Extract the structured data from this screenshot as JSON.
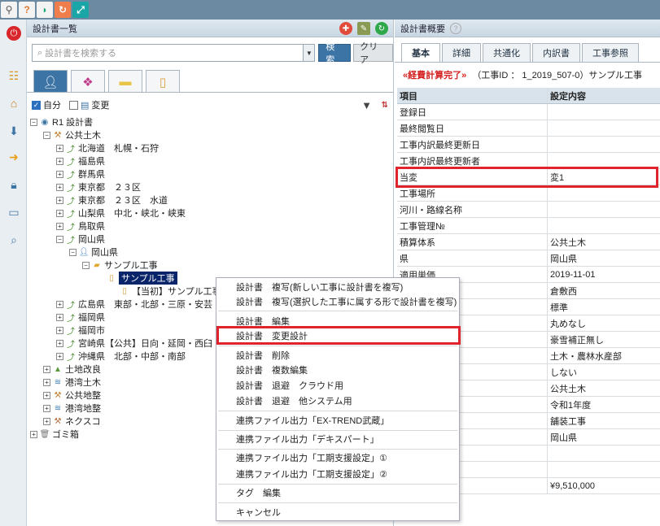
{
  "colors": {
    "toolbar": "#6d8aa3",
    "accent": "#3d74a6",
    "highlight_box": "#e0242e",
    "selection": "#0a246a"
  },
  "toolbar": {
    "icons": [
      "pin-icon",
      "help-icon",
      "shield-icon",
      "refresh-icon",
      "resize-icon"
    ]
  },
  "left_panel": {
    "title": "設計書一覧",
    "search": {
      "placeholder": "設計書を検索する",
      "search_label": "検索",
      "clear_label": "クリア"
    },
    "filters": {
      "own_label": "自分",
      "own_checked": true,
      "change_label": "変更",
      "change_checked": false
    },
    "tree": {
      "root": "R1 設計書",
      "public_works": "公共土木",
      "pref_1": "北海道　札幌・石狩",
      "pref_2": "福島県",
      "pref_3": "群馬県",
      "pref_4": "東京都　２３区",
      "pref_5": "東京都　２３区　水道",
      "pref_6": "山梨県　中北・峡北・峡東",
      "pref_7": "鳥取県",
      "pref_8": "岡山県",
      "okayama_user": "岡山県",
      "sample_folder": "サンプル工事",
      "selected": "サンプル工事",
      "initial": "【当初】サンプル工事",
      "pref_9": "広島県　東部・北部・三原・安芸",
      "pref_10": "福岡県",
      "pref_11": "福岡市",
      "pref_12": "宮崎県【公共】日向・延岡・西臼",
      "pref_13": "沖縄県　北部・中部・南部",
      "land": "土地改良",
      "harbor": "港湾土木",
      "park": "公共地整",
      "harbor2": "港湾地整",
      "nexco": "ネクスコ",
      "trash": "ゴミ箱"
    }
  },
  "context_menu": {
    "items": [
      "設計書　複写(新しい工事に設計書を複写)",
      "設計書　複写(選択した工事に属する形で設計書を複写)",
      "設計書　編集",
      "設計書　変更設計",
      "設計書　削除",
      "設計書　複数編集",
      "設計書　退避　クラウド用",
      "設計書　退避　他システム用",
      "連携ファイル出力「EX-TREND武蔵」",
      "連携ファイル出力「デキスパート」",
      "連携ファイル出力「工期支援設定」①",
      "連携ファイル出力「工期支援設定」②",
      "タグ　編集",
      "キャンセル"
    ]
  },
  "right_panel": {
    "title": "設計書概要",
    "tabs": [
      "基本",
      "詳細",
      "共通化",
      "内訳書",
      "工事参照"
    ],
    "status_done": "«経費計算完了»",
    "status_info": "（工事ID ： 1_2019_507-0）サンプル工事",
    "grid": {
      "header": [
        "項目",
        "設定内容"
      ],
      "rows": [
        [
          "登録日",
          ""
        ],
        [
          "最終閲覧日",
          ""
        ],
        [
          "工事内訳最終更新日",
          ""
        ],
        [
          "工事内訳最終更新者",
          ""
        ],
        [
          "当変",
          "変1"
        ],
        [
          "工事場所",
          ""
        ],
        [
          "河川・路線名称",
          ""
        ],
        [
          "工事管理№",
          ""
        ],
        [
          "積算体系",
          "公共土木"
        ],
        [
          "県",
          "岡山県"
        ],
        [
          "適用単価",
          "2019-11-01"
        ],
        [
          "",
          "倉敷西"
        ],
        [
          "",
          "標準"
        ],
        [
          "",
          "丸めなし"
        ],
        [
          "",
          "豪雪補正無し"
        ],
        [
          "",
          "土木・農林水産部"
        ],
        [
          "",
          "しない"
        ],
        [
          "体系",
          "公共土木"
        ],
        [
          "体系",
          "令和1年度"
        ],
        [
          "種名称",
          "舗装工事"
        ],
        [
          "",
          "岡山県"
        ],
        [
          "",
          ""
        ],
        [
          "",
          ""
        ],
        [
          "税抜き)",
          "¥9,510,000"
        ]
      ]
    }
  }
}
